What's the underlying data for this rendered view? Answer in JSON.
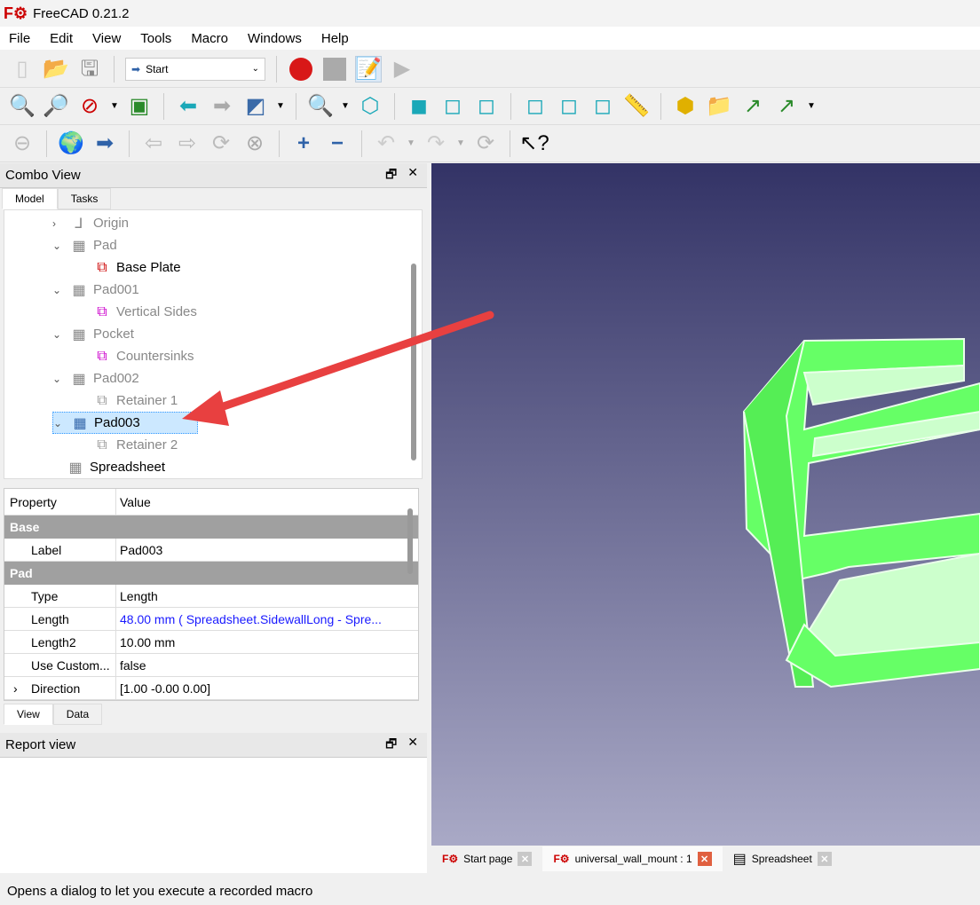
{
  "app": {
    "title": "FreeCAD 0.21.2"
  },
  "menu": [
    "File",
    "Edit",
    "View",
    "Tools",
    "Macro",
    "Windows",
    "Help"
  ],
  "toolbar": {
    "workbench": "Start"
  },
  "combo": {
    "title": "Combo View",
    "tabs": [
      "Model",
      "Tasks"
    ]
  },
  "tree": [
    {
      "label": "Origin",
      "level": 1,
      "chev": "›",
      "icon": "origin-icon",
      "glyph": "⅃",
      "grey": true
    },
    {
      "label": "Pad",
      "level": 1,
      "chev": "⌄",
      "icon": "pad-icon",
      "glyph": "▦",
      "grey": true
    },
    {
      "label": "Base Plate",
      "level": 2,
      "chev": "",
      "icon": "sketch-icon",
      "glyph": "⧉",
      "grey": false,
      "color": "#cc0000"
    },
    {
      "label": "Pad001",
      "level": 1,
      "chev": "⌄",
      "icon": "pad-icon",
      "glyph": "▦",
      "grey": true
    },
    {
      "label": "Vertical Sides",
      "level": 2,
      "chev": "",
      "icon": "sketch-icon",
      "glyph": "⧉",
      "grey": true,
      "color": "#cc00cc"
    },
    {
      "label": "Pocket",
      "level": 1,
      "chev": "⌄",
      "icon": "pocket-icon",
      "glyph": "▦",
      "grey": true
    },
    {
      "label": "Countersinks",
      "level": 2,
      "chev": "",
      "icon": "sketch-icon",
      "glyph": "⧉",
      "grey": true,
      "color": "#cc00cc"
    },
    {
      "label": "Pad002",
      "level": 1,
      "chev": "⌄",
      "icon": "pad-icon",
      "glyph": "▦",
      "grey": true
    },
    {
      "label": "Retainer 1",
      "level": 2,
      "chev": "",
      "icon": "sketch-icon",
      "glyph": "⧉",
      "grey": true,
      "color": "#999"
    },
    {
      "label": "Pad003",
      "level": 1,
      "chev": "⌄",
      "icon": "pad-icon",
      "glyph": "▦",
      "grey": false,
      "selected": true,
      "color": "#3366aa"
    },
    {
      "label": "Retainer 2",
      "level": 2,
      "chev": "",
      "icon": "sketch-icon",
      "glyph": "⧉",
      "grey": true,
      "color": "#999"
    },
    {
      "label": "Spreadsheet",
      "level": 0,
      "chev": "",
      "icon": "spreadsheet-icon",
      "glyph": "▦",
      "grey": false
    }
  ],
  "properties": {
    "headers": [
      "Property",
      "Value"
    ],
    "groups": [
      {
        "name": "Base",
        "rows": [
          {
            "k": "Label",
            "v": "Pad003"
          }
        ]
      },
      {
        "name": "Pad",
        "rows": [
          {
            "k": "Type",
            "v": "Length"
          },
          {
            "k": "Length",
            "v": "48.00 mm  ( Spreadsheet.SidewallLong - Spre...",
            "link": true
          },
          {
            "k": "Length2",
            "v": "10.00 mm"
          },
          {
            "k": "Use Custom...",
            "v": "false"
          },
          {
            "k": "Direction",
            "v": "[1.00 -0.00 0.00]",
            "expand": true
          }
        ]
      }
    ],
    "tabs": [
      "View",
      "Data"
    ]
  },
  "report": {
    "title": "Report view"
  },
  "doc_tabs": [
    {
      "label": "Start page"
    },
    {
      "label": "universal_wall_mount : 1",
      "active": true
    },
    {
      "label": "Spreadsheet"
    }
  ],
  "status": "Opens a dialog to let you execute a recorded macro",
  "colors": {
    "model": "#66ff66",
    "arrow": "#e84040",
    "selection": "#cce8ff"
  }
}
